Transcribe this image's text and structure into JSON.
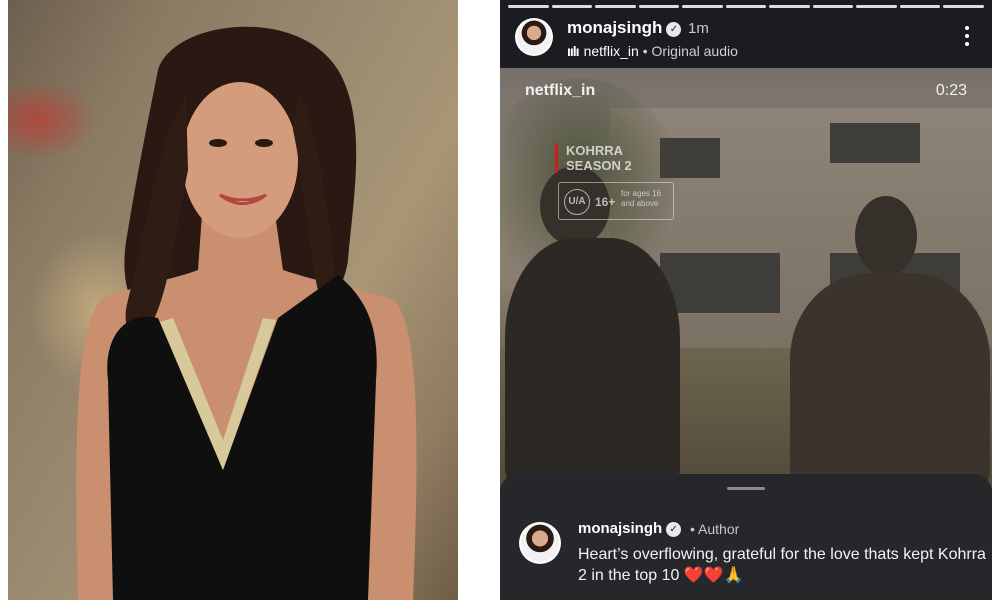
{
  "story": {
    "username": "monajsingh",
    "time": "1m",
    "audio_source": "netflix_in",
    "audio_separator": "•",
    "audio_label": "Original audio",
    "progress_segments": 11
  },
  "video": {
    "overlay_user": "netflix_in",
    "timestamp": "0:23",
    "show_title_line1": "KOHRRA",
    "show_title_line2": "SEASON 2",
    "rating_badge": "U/A",
    "rating_age": "16+",
    "rating_note": "for ages 16 and above"
  },
  "comment": {
    "username": "monajsingh",
    "role_separator": "•",
    "role": "Author",
    "text": "Heart’s overflowing, grateful for the love thats kept Kohrra 2 in the top 10 ❤️❤️🙏"
  },
  "icons": [
    "verified-badge-icon",
    "audio-bars-icon",
    "more-options-icon"
  ],
  "colors": {
    "accent_red": "#d01c1c",
    "sheet_bg": "#25272b",
    "header_bg": "#1b1c1f"
  }
}
